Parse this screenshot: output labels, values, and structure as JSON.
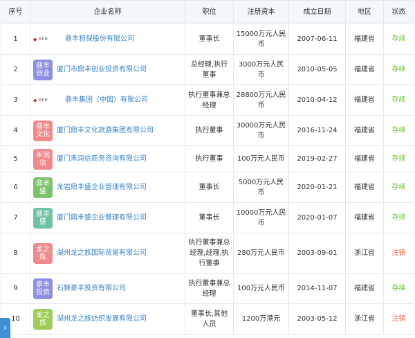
{
  "headers": [
    "序号",
    "企业名称",
    "职位",
    "注册资本",
    "成立日期",
    "地区",
    "状态"
  ],
  "rows": [
    {
      "no": "1",
      "logo": {
        "type": "dfh",
        "mark": "◆",
        "text": "DFH"
      },
      "name": "鼎丰担保股份有限公司",
      "position": "董事长",
      "capital": "15000万元人民币",
      "date": "2007-06-11",
      "region": "福建省",
      "status": "存续",
      "status_type": "active"
    },
    {
      "no": "2",
      "logo": {
        "type": "text",
        "text": "鼎丰创业",
        "color": "#8d8fe0"
      },
      "name": "厦门市鼎丰创业投资有限公司",
      "position": "总经理,执行董事",
      "capital": "3000万元人民币",
      "date": "2010-05-05",
      "region": "福建省",
      "status": "存续",
      "status_type": "active"
    },
    {
      "no": "3",
      "logo": {
        "type": "dfh",
        "mark": "◆",
        "text": "DFH"
      },
      "name": "鼎丰集团（中国）有限公司",
      "position": "执行董事兼总经理",
      "capital": "28800万元人民币",
      "date": "2010-04-12",
      "region": "福建省",
      "status": "存续",
      "status_type": "active"
    },
    {
      "no": "4",
      "logo": {
        "type": "text",
        "text": "鼎丰文化",
        "color": "#ef8a8c"
      },
      "name": "厦门鼎丰文化旅游集团有限公司",
      "position": "执行董事",
      "capital": "30000万元人民币",
      "date": "2016-11-24",
      "region": "福建省",
      "status": "存续",
      "status_type": "active"
    },
    {
      "no": "5",
      "logo": {
        "type": "text",
        "text": "禾润信",
        "color": "#ef8a8c"
      },
      "name": "厦门禾润信商务咨询有限公司",
      "position": "执行董事",
      "capital": "100万元人民币",
      "date": "2019-02-27",
      "region": "福建省",
      "status": "存续",
      "status_type": "active"
    },
    {
      "no": "6",
      "logo": {
        "type": "text",
        "text": "鼎丰盛",
        "color": "#7cc36b"
      },
      "name": "龙岩鼎丰盛企业管理有限公司",
      "position": "董事长",
      "capital": "5000万元人民币",
      "date": "2020-01-21",
      "region": "福建省",
      "status": "存续",
      "status_type": "active"
    },
    {
      "no": "7",
      "logo": {
        "type": "text",
        "text": "鼎丰盛",
        "color": "#6fc2a4"
      },
      "name": "厦门鼎丰盛企业管理有限公司",
      "position": "董事长",
      "capital": "10000万元人民币",
      "date": "2020-01-07",
      "region": "福建省",
      "status": "存续",
      "status_type": "active"
    },
    {
      "no": "8",
      "logo": {
        "type": "text",
        "text": "龙之族",
        "color": "#ef8a8c"
      },
      "name": "湖州龙之族国际贸易有限公司",
      "position": "执行董事兼总经理,经理,执行董事",
      "capital": "280万元人民币",
      "date": "2003-09-01",
      "region": "浙江省",
      "status": "注销",
      "status_type": "cancelled"
    },
    {
      "no": "9",
      "logo": {
        "type": "text",
        "text": "豪丰投资",
        "color": "#8d8fe0"
      },
      "name": "石狮豪丰投资有限公司",
      "position": "执行董事兼总经理",
      "capital": "100万元人民币",
      "date": "2014-11-07",
      "region": "福建省",
      "status": "存续",
      "status_type": "active"
    },
    {
      "no": "10",
      "logo": {
        "type": "text",
        "text": "龙之族",
        "color": "#9fcb5a"
      },
      "name": "湖州龙之族纺织发展有限公司",
      "position": "董事长,其他人员",
      "capital": "1200万港元",
      "date": "2003-05-12",
      "region": "浙江省",
      "status": "注销",
      "status_type": "cancelled"
    }
  ],
  "side_tab": {
    "icon": "chevron-right-icon",
    "glyph": "›"
  }
}
